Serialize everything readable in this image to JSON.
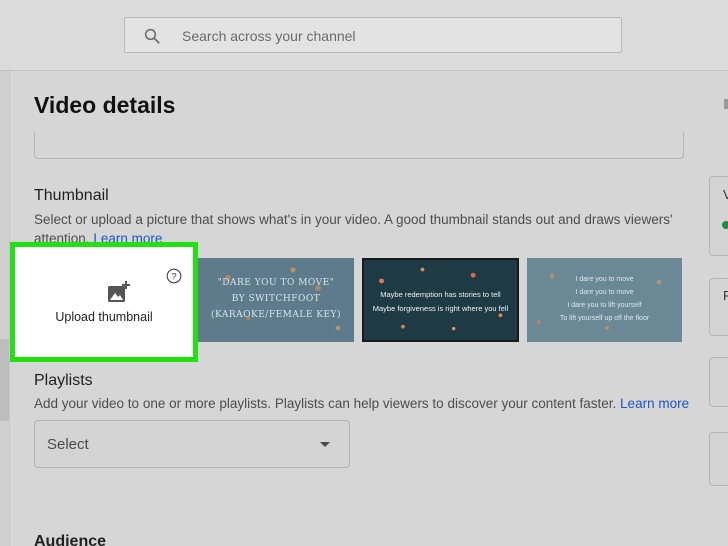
{
  "search": {
    "placeholder": "Search across your channel",
    "icon": "search-icon"
  },
  "dialog": {
    "title": "Video details"
  },
  "thumbnail": {
    "heading": "Thumbnail",
    "description": "Select or upload a picture that shows what's in your video. A good thumbnail stands out and draws viewers' attention.",
    "learn_more": "Learn more",
    "upload": {
      "label": "Upload thumbnail",
      "icon": "add-photo-icon",
      "help_icon": "help-icon"
    },
    "options": [
      {
        "lines": [
          "\"DARE YOU TO MOVE\"",
          "BY SWITCHFOOT",
          "(KARAOKE/FEMALE KEY)"
        ]
      },
      {
        "lines": [
          "Maybe redemption has stories to tell",
          "Maybe forgiveness is right where you fell"
        ]
      },
      {
        "lines": [
          "I dare you to move",
          "I dare you to move",
          "I dare you to lift yourself",
          "To lift yourself up off the floor"
        ]
      }
    ]
  },
  "playlists": {
    "heading": "Playlists",
    "description": "Add your video to one or more playlists. Playlists can help viewers to discover your content faster.",
    "learn_more": "Learn more",
    "select_value": "Select"
  },
  "sidebar_right": {
    "letters": [
      "V",
      "R"
    ]
  },
  "audience": {
    "heading": "Audience"
  },
  "colors": {
    "highlight": "#22e012",
    "link": "#1a56c8"
  }
}
